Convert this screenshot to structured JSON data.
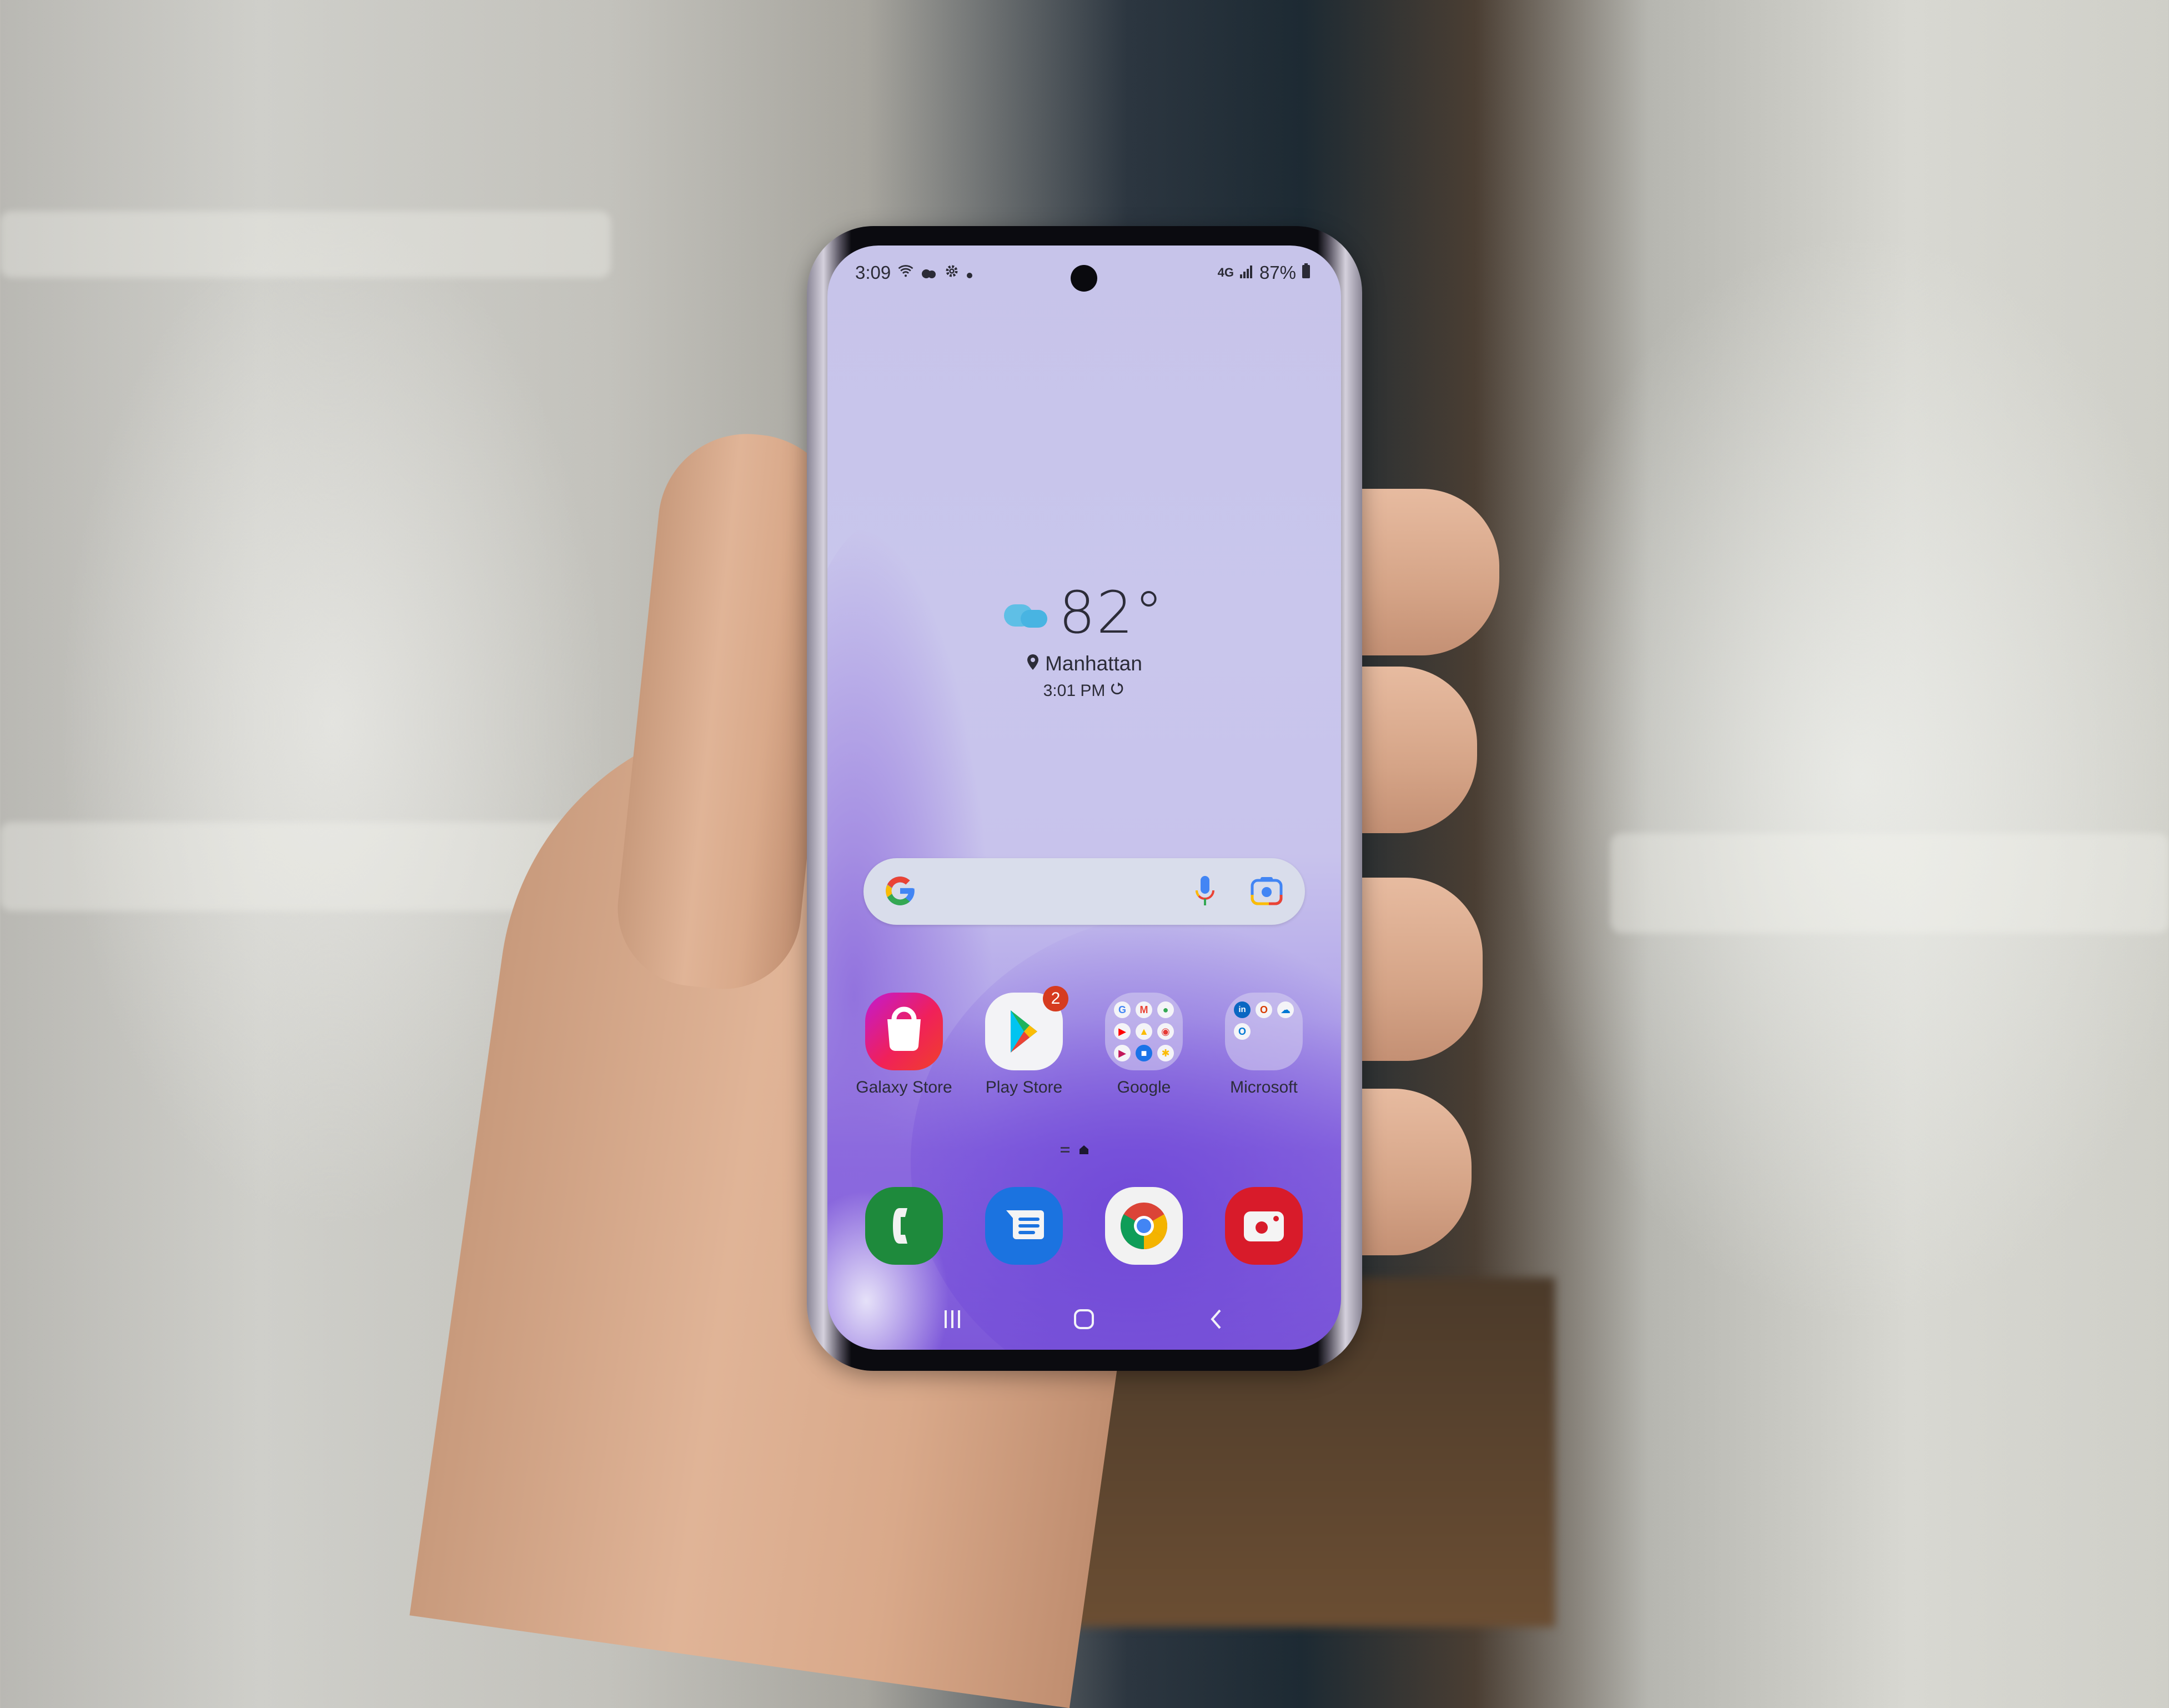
{
  "status_bar": {
    "time": "3:09",
    "left_icons": [
      "wifi-icon",
      "cloud-icon",
      "settings-gear-icon",
      "notification-dot-icon"
    ],
    "network": "4G",
    "battery": "87%"
  },
  "weather_widget": {
    "condition_icon": "partly-cloudy-icon",
    "temperature": "82°",
    "location": "Manhattan",
    "updated_time": "3:01 PM"
  },
  "search_bar": {
    "logo": "G",
    "mic_icon": "microphone-icon",
    "lens_icon": "google-lens-icon"
  },
  "home_apps": [
    {
      "label": "Galaxy Store",
      "icon": "shopping-bag-icon"
    },
    {
      "label": "Play Store",
      "icon": "play-store-icon",
      "badge": "2"
    },
    {
      "label": "Google",
      "icon": "folder-icon",
      "folder_apps": [
        "Google",
        "Gmail",
        "Maps",
        "YouTube",
        "Drive",
        "YT Music",
        "Play Movies",
        "Duo",
        "Photos"
      ]
    },
    {
      "label": "Microsoft",
      "icon": "folder-icon",
      "folder_apps": [
        "LinkedIn",
        "Office",
        "OneDrive",
        "Outlook"
      ]
    }
  ],
  "page_indicator": {
    "pages": 2,
    "current": 1
  },
  "dock_apps": [
    {
      "name": "Phone",
      "icon": "phone-icon",
      "color": "#1e8a3c"
    },
    {
      "name": "Messages",
      "icon": "messages-icon",
      "color": "#1b73e0"
    },
    {
      "name": "Chrome",
      "icon": "chrome-icon",
      "color": "#f2f2f2"
    },
    {
      "name": "Camera",
      "icon": "camera-icon",
      "color": "#d81b2a"
    }
  ],
  "nav_bar": {
    "recents": "recents-icon",
    "home": "home-icon",
    "back": "back-icon"
  }
}
